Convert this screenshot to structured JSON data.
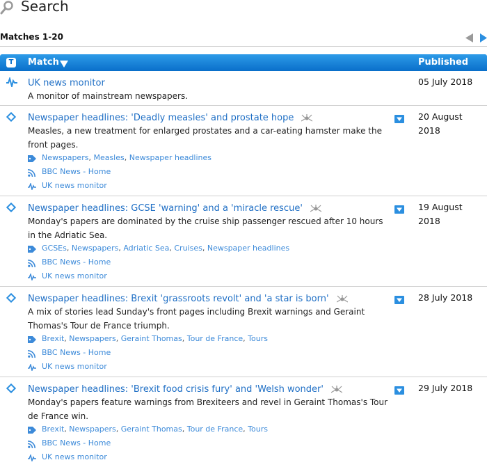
{
  "header": {
    "title": "Search"
  },
  "matches": {
    "label": "Matches 1-20"
  },
  "table": {
    "type_badge": "T",
    "col_match": "Match",
    "col_published": "Published"
  },
  "rows": [
    {
      "title": "UK news monitor",
      "desc": "A monitor of mainstream newspapers.",
      "date_line1": "05 July 2018",
      "date_line2": ""
    },
    {
      "title": "Newspaper headlines: 'Deadly measles' and prostate hope",
      "desc": "Measles, a new treatment for enlarged prostates and a car-eating hamster make the front pages.",
      "date_line1": "20 August",
      "date_line2": "2018",
      "tags": [
        "Newspapers",
        "Measles",
        "Newspaper headlines"
      ],
      "source": "BBC News - Home",
      "monitor": "UK news monitor"
    },
    {
      "title": "Newspaper headlines: GCSE 'warning' and a 'miracle rescue'",
      "desc": "Monday's papers are dominated by the cruise ship passenger rescued after 10 hours in the Adriatic Sea.",
      "date_line1": "19 August",
      "date_line2": "2018",
      "tags": [
        "GCSEs",
        "Newspapers",
        "Adriatic Sea",
        "Cruises",
        "Newspaper headlines"
      ],
      "source": "BBC News - Home",
      "monitor": "UK news monitor"
    },
    {
      "title": "Newspaper headlines: Brexit 'grassroots revolt' and 'a star is born'",
      "desc": "A mix of stories lead Sunday's front pages including Brexit warnings and Geraint Thomas's Tour de France triumph.",
      "date_line1": "28 July 2018",
      "date_line2": "",
      "tags": [
        "Brexit",
        "Newspapers",
        "Geraint Thomas",
        "Tour de France",
        "Tours"
      ],
      "source": "BBC News - Home",
      "monitor": "UK news monitor"
    },
    {
      "title": "Newspaper headlines: 'Brexit food crisis fury' and 'Welsh wonder'",
      "desc": "Monday's papers feature warnings from Brexiteers and revel in Geraint Thomas's Tour de France win.",
      "date_line1": "29 July 2018",
      "date_line2": "",
      "tags": [
        "Brexit",
        "Newspapers",
        "Geraint Thomas",
        "Tour de France",
        "Tours"
      ],
      "source": "BBC News - Home",
      "monitor": "UK news monitor"
    }
  ],
  "icons": {
    "search": "magnifier-icon",
    "prev": "triangle-left-icon",
    "next": "triangle-right-icon",
    "monitor": "activity-wave-icon",
    "item": "diamond-tag-icon",
    "spider": "spider-icon",
    "dropdown": "dropdown-icon",
    "tag": "tag-icon",
    "rss": "rss-icon"
  },
  "colors": {
    "accent": "#1f6fc5",
    "header": "#0a6fca",
    "link_light": "#3c8ad9",
    "icon": "#2b8fe0"
  }
}
